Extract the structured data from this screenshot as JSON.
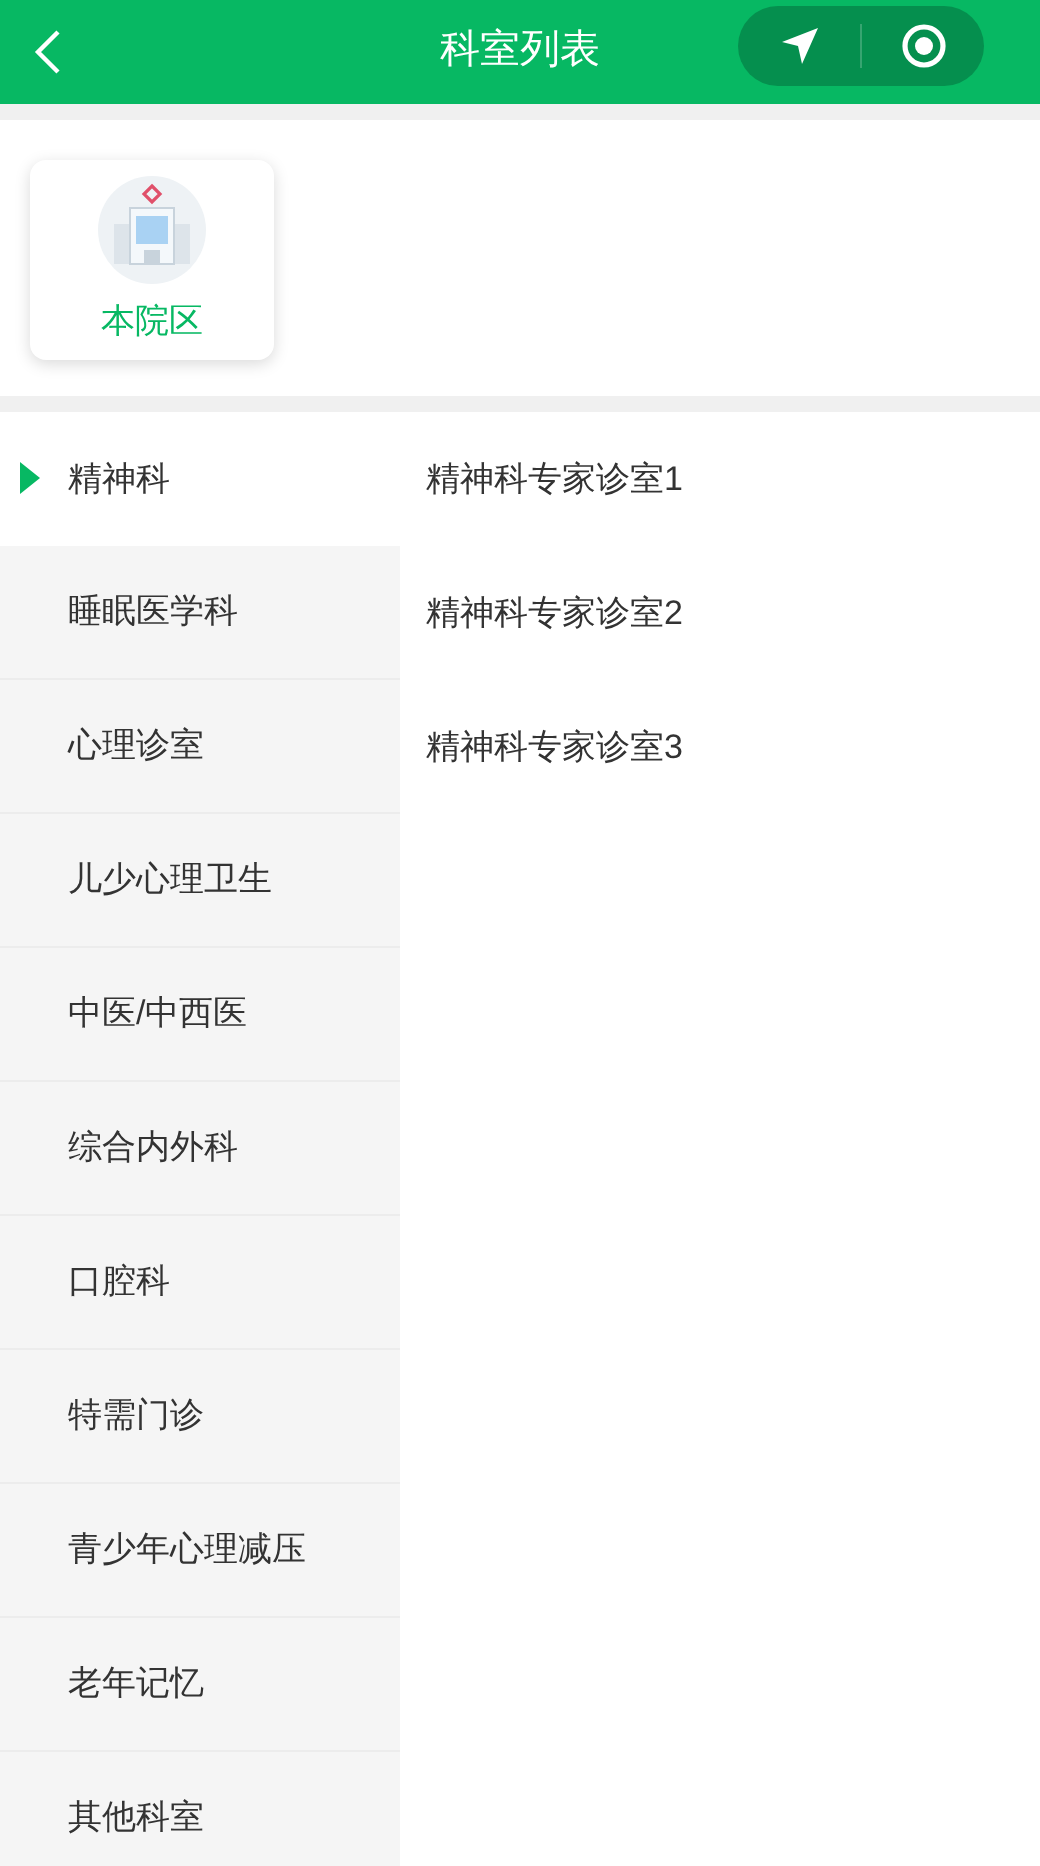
{
  "nav_bar": {
    "title": "科室列表"
  },
  "campuses": [
    {
      "label": "本院区",
      "selected": true
    }
  ],
  "departments": [
    {
      "label": "精神科",
      "selected": true
    },
    {
      "label": "睡眠医学科",
      "selected": false
    },
    {
      "label": "心理诊室",
      "selected": false
    },
    {
      "label": "儿少心理卫生",
      "selected": false
    },
    {
      "label": "中医/中西医",
      "selected": false
    },
    {
      "label": "综合内外科",
      "selected": false
    },
    {
      "label": "口腔科",
      "selected": false
    },
    {
      "label": "特需门诊",
      "selected": false
    },
    {
      "label": "青少年心理减压",
      "selected": false
    },
    {
      "label": "老年记忆",
      "selected": false
    },
    {
      "label": "其他科室",
      "selected": false
    }
  ],
  "clinics": [
    "精神科专家诊室1",
    "精神科专家诊室2",
    "精神科专家诊室3"
  ]
}
